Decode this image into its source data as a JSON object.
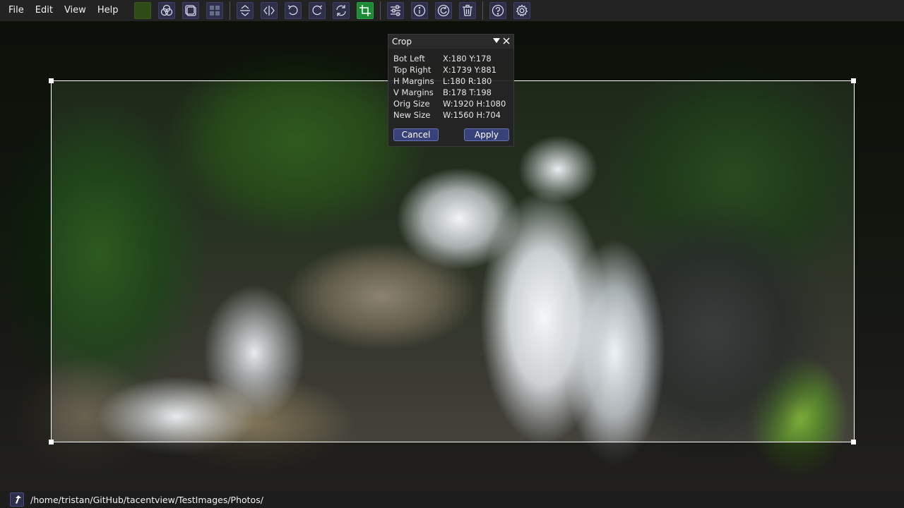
{
  "menu": {
    "file": "File",
    "edit": "Edit",
    "view": "View",
    "help": "Help"
  },
  "toolbar": {
    "icons": [
      "color-swatch-icon",
      "channels-icon",
      "tile-icon",
      "grid-icon",
      "flip-vertical-icon",
      "flip-horizontal-icon",
      "rotate-ccw-icon",
      "rotate-cw-icon",
      "rotate-arbitrary-icon",
      "crop-icon",
      "adjust-icon",
      "info-icon",
      "refresh-icon",
      "delete-icon",
      "help-icon",
      "settings-icon"
    ],
    "active_tool": "crop-icon",
    "swatch_color": "#2e4a17",
    "crop_active_color": "#1f8a35"
  },
  "crop_dialog": {
    "title": "Crop",
    "rows": [
      {
        "label": "Bot Left",
        "value": "X:180 Y:178"
      },
      {
        "label": "Top Right",
        "value": "X:1739 Y:881"
      },
      {
        "label": "H Margins",
        "value": "L:180 R:180"
      },
      {
        "label": "V Margins",
        "value": "B:178 T:198"
      },
      {
        "label": "Orig Size",
        "value": "W:1920 H:1080"
      },
      {
        "label": "New Size",
        "value": "W:1560 H:704"
      }
    ],
    "cancel_label": "Cancel",
    "apply_label": "Apply"
  },
  "statusbar": {
    "path": "/home/tristan/GitHub/tacentview/TestImages/Photos/"
  },
  "colors": {
    "accent": "#39417a",
    "crop_border": "#ffffff"
  }
}
